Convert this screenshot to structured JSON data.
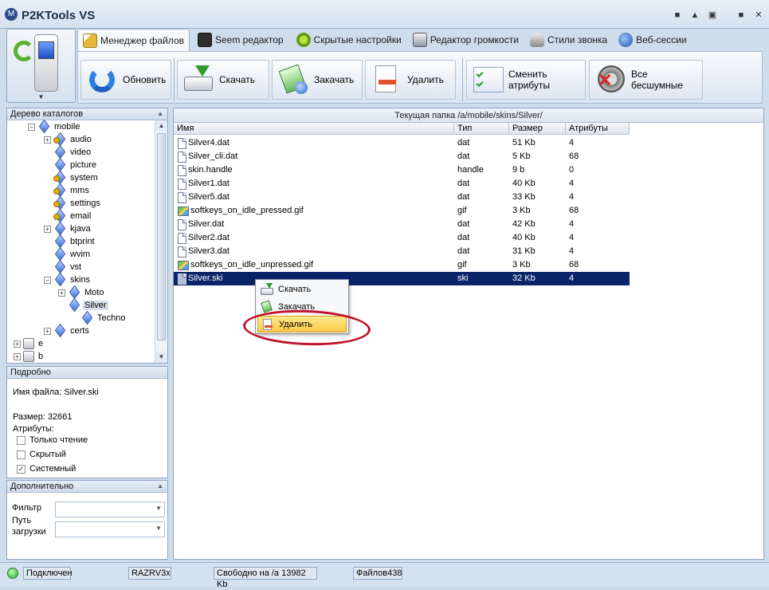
{
  "window": {
    "title": "P2KTools VS",
    "logo": "M"
  },
  "window_controls": [
    "■",
    "▲",
    "▣",
    "■",
    "✕"
  ],
  "tabs": [
    {
      "label": "Менеджер файлов",
      "icon": "file-manager-icon",
      "active": true
    },
    {
      "label": "Seem редактор",
      "icon": "seem-editor-icon"
    },
    {
      "label": "Скрытые настройки",
      "icon": "hidden-settings-icon"
    },
    {
      "label": "Редактор громкости",
      "icon": "volume-editor-icon"
    },
    {
      "label": "Стили звонка",
      "icon": "ring-styles-icon"
    },
    {
      "label": "Веб-сессии",
      "icon": "web-sessions-icon"
    }
  ],
  "toolbar": {
    "refresh": "Обновить",
    "download": "Скачать",
    "upload": "Закачать",
    "delete": "Удалить",
    "change_attrs": "Сменить атрибуты",
    "all_silent": "Все бесшумные"
  },
  "tree": {
    "header": "Дерево каталогов",
    "items": [
      {
        "label": "mobile",
        "expander": "−"
      },
      {
        "label": "audio",
        "expander": "+"
      },
      {
        "label": "video"
      },
      {
        "label": "picture"
      },
      {
        "label": "system"
      },
      {
        "label": "mms"
      },
      {
        "label": "settings"
      },
      {
        "label": "email"
      },
      {
        "label": "kjava",
        "expander": "+"
      },
      {
        "label": "btprint"
      },
      {
        "label": "wvim"
      },
      {
        "label": "vst"
      },
      {
        "label": "skins",
        "expander": "−"
      },
      {
        "label": "Moto",
        "expander": "+"
      },
      {
        "label": "Silver",
        "selected": true
      },
      {
        "label": "Techno"
      },
      {
        "label": "certs",
        "expander": "+"
      },
      {
        "label": "e",
        "expander": "+"
      },
      {
        "label": "b",
        "expander": "+"
      }
    ]
  },
  "details": {
    "header": "Подробно",
    "filename": "Имя файла: Silver.ski",
    "size": "Размер: 32661",
    "attrs_label": "Атрибуты:",
    "attrs": [
      {
        "label": "Только чтение",
        "checked": false
      },
      {
        "label": "Скрытый",
        "checked": false
      },
      {
        "label": "Системный",
        "checked": true
      }
    ]
  },
  "extra": {
    "header": "Дополнительно",
    "filter_label": "Фильтр",
    "path_label_1": "Путь",
    "path_label_2": "загрузки"
  },
  "files": {
    "path": "Текущая папка /a/mobile/skins/Silver/",
    "columns": [
      "Имя",
      "Тип",
      "Размер",
      "Атрибуты"
    ],
    "rows": [
      {
        "name": "Silver4.dat",
        "type": "dat",
        "size": "51 Kb",
        "attr": "4",
        "icon": "doc"
      },
      {
        "name": "Silver_cli.dat",
        "type": "dat",
        "size": "5 Kb",
        "attr": "68",
        "icon": "doc"
      },
      {
        "name": "skin.handle",
        "type": "handle",
        "size": "9 b",
        "attr": "0",
        "icon": "doc"
      },
      {
        "name": "Silver1.dat",
        "type": "dat",
        "size": "40 Kb",
        "attr": "4",
        "icon": "doc"
      },
      {
        "name": "Silver5.dat",
        "type": "dat",
        "size": "33 Kb",
        "attr": "4",
        "icon": "doc"
      },
      {
        "name": "softkeys_on_idle_pressed.gif",
        "type": "gif",
        "size": "3 Kb",
        "attr": "68",
        "icon": "img"
      },
      {
        "name": "Silver.dat",
        "type": "dat",
        "size": "42 Kb",
        "attr": "4",
        "icon": "doc"
      },
      {
        "name": "Silver2.dat",
        "type": "dat",
        "size": "40 Kb",
        "attr": "4",
        "icon": "doc"
      },
      {
        "name": "Silver3.dat",
        "type": "dat",
        "size": "31 Kb",
        "attr": "4",
        "icon": "doc"
      },
      {
        "name": "softkeys_on_idle_unpressed.gif",
        "type": "gif",
        "size": "3 Kb",
        "attr": "68",
        "icon": "img"
      },
      {
        "name": "Silver.ski",
        "type": "ski",
        "size": "32 Kb",
        "attr": "4",
        "icon": "doc",
        "selected": true
      }
    ]
  },
  "context_menu": {
    "items": [
      {
        "label": "Скачать",
        "icon": "download-icon"
      },
      {
        "label": "Закачать",
        "icon": "upload-icon"
      },
      {
        "label": "Удалить",
        "icon": "delete-icon",
        "highlighted": true
      }
    ]
  },
  "status": {
    "connection": "Подключен",
    "model": "RAZRV3x",
    "free": "Свободно на /a 13982 Kb",
    "files": "Файлов438"
  },
  "colors": {
    "accent": "#0a246a",
    "annotation": "#c0132c",
    "highlight": "#fbc94b",
    "connected": "#1fb02a"
  }
}
